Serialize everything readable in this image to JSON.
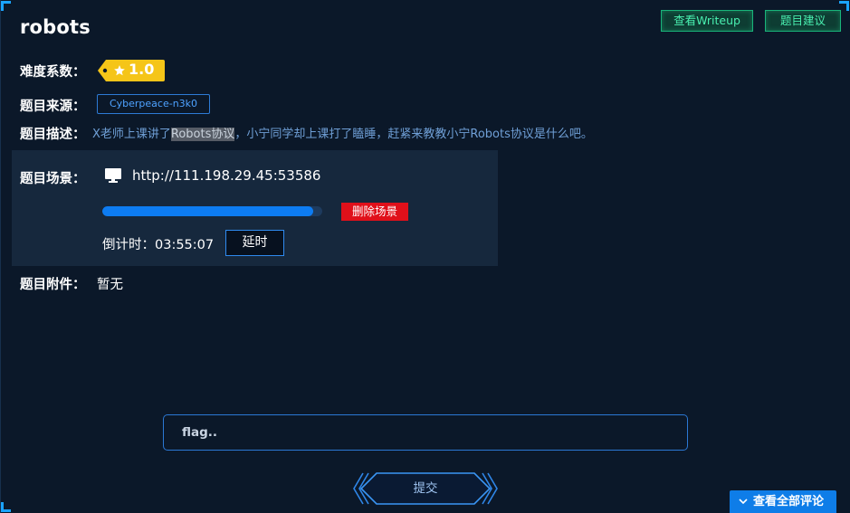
{
  "challenge": {
    "title": "robots",
    "difficulty_label": "难度系数：",
    "difficulty_value": "1.0",
    "source_label": "题目来源：",
    "source_value": "Cyberpeace-n3k0",
    "description_label": "题目描述：",
    "description_pre": "X老师上课讲了",
    "description_highlight": "Robots协议",
    "description_post": "，小宁同学却上课打了瞌睡，赶紧来教教小宁Robots协议是什么吧。",
    "attachment_label": "题目附件：",
    "attachment_value": "暂无"
  },
  "header_buttons": {
    "writeup": "查看Writeup",
    "suggest": "题目建议"
  },
  "scene": {
    "label": "题目场景：",
    "url": "http://111.198.29.45:53586",
    "progress_fraction": 0.96,
    "delete_label": "删除场景",
    "countdown_label": "倒计时：",
    "countdown_value": "03:55:07",
    "delay_label": "延时"
  },
  "flag_input": {
    "placeholder": "flag..",
    "value": ""
  },
  "submit_label": "提交",
  "comments_button": "查看全部评论",
  "colors": {
    "background": "#0b1829",
    "panel": "#16283d",
    "accent_blue": "#0d7cf2",
    "accent_green": "#49f0b0",
    "delete_red": "#e0101a",
    "difficulty_yellow": "#f5c518"
  },
  "icons": {
    "difficulty_star": "star-icon",
    "scene_monitor": "monitor-icon",
    "comments_chevron": "chevron-down-icon"
  }
}
